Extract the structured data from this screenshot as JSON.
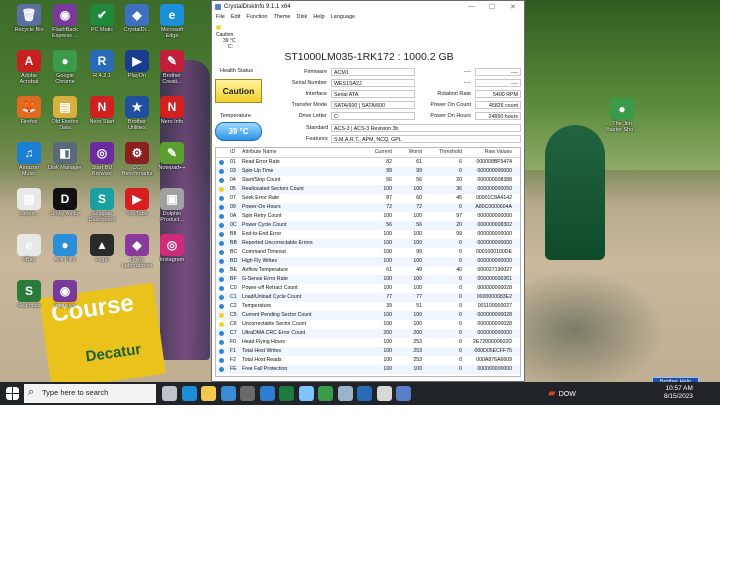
{
  "desktop_icons": [
    {
      "label": "Recycle Bin",
      "glyph": "🗑",
      "color": "#5b6fa0"
    },
    {
      "label": "FlashBack\nExpress ...",
      "glyph": "◉",
      "color": "#7a3a9a"
    },
    {
      "label": "PC Matic",
      "glyph": "✔",
      "color": "#1f8a3a"
    },
    {
      "label": "CrystalDi...",
      "glyph": "◆",
      "color": "#3f6fc0"
    },
    {
      "label": "Microsoft\nEdge",
      "glyph": "e",
      "color": "#1b8fd8"
    },
    {
      "label": "Adobe\nAcrobat",
      "glyph": "A",
      "color": "#c8201f"
    },
    {
      "label": "Google\nChrome",
      "glyph": "●",
      "color": "#3a9b4a"
    },
    {
      "label": "R 4.2.1",
      "glyph": "R",
      "color": "#2a6bb8"
    },
    {
      "label": "PlayOn",
      "glyph": "▶",
      "color": "#1a3d8f"
    },
    {
      "label": "Brother\nCreati...",
      "glyph": "✎",
      "color": "#c21f3a"
    },
    {
      "label": "Firefox",
      "glyph": "🦊",
      "color": "#e06a1f"
    },
    {
      "label": "Old Firefox\nData",
      "glyph": "▤",
      "color": "#d8b040"
    },
    {
      "label": "Nero Start",
      "glyph": "N",
      "color": "#d02020"
    },
    {
      "label": "Brother\nUtilities",
      "glyph": "★",
      "color": "#1f4fa0"
    },
    {
      "label": "Nero Info",
      "glyph": "N",
      "color": "#d02020"
    },
    {
      "label": "Amazon\nMusic",
      "glyph": "♫",
      "color": "#1a7fd0"
    },
    {
      "label": "Disk Manager",
      "glyph": "◧",
      "color": "#5a6a7a"
    },
    {
      "label": "Start BU\nBrowser",
      "glyph": "◎",
      "color": "#6a2aa0"
    },
    {
      "label": "CCI\nBenchmarks",
      "glyph": "⚙",
      "color": "#8a2020"
    },
    {
      "label": "Notepad++",
      "glyph": "✎",
      "color": "#5aa030"
    },
    {
      "label": "Lanes...",
      "glyph": "▤",
      "color": "#e8e8e8"
    },
    {
      "label": "Dolby Audio",
      "glyph": "D",
      "color": "#111111"
    },
    {
      "label": "Seagate\nDashboard",
      "glyph": "S",
      "color": "#1aa0a0"
    },
    {
      "label": "YouTube",
      "glyph": "▶",
      "color": "#d81f1f"
    },
    {
      "label": "Dolphin\nProduct...",
      "glyph": "▣",
      "color": "#a0a0a0"
    },
    {
      "label": "eBay",
      "glyph": "e",
      "color": "#e8e8e8"
    },
    {
      "label": "Ask Pilot",
      "glyph": "●",
      "color": "#2a8fd8"
    },
    {
      "label": "Legal",
      "glyph": "▲",
      "color": "#2a2a2a"
    },
    {
      "label": "Dolby\nLaboratories",
      "glyph": "◆",
      "color": "#8a3a9a"
    },
    {
      "label": "Instagram",
      "glyph": "◎",
      "color": "#d02a7a"
    },
    {
      "label": "Seafoods",
      "glyph": "S",
      "color": "#2a7a3a"
    },
    {
      "label": "Inclusive",
      "glyph": "◉",
      "color": "#7a3a9a"
    },
    {
      "label": "The Jim\nBaxter Sho...",
      "glyph": "●",
      "color": "#3a9b4a"
    }
  ],
  "photo": {
    "sign_title": "Course",
    "sign_name": "Decatur"
  },
  "window": {
    "title": "CrystalDiskInfo 9.1.1 x64",
    "controls": {
      "minimize": "—",
      "maximize": "☐",
      "close": "✕"
    },
    "menu": [
      "File",
      "Edit",
      "Function",
      "Theme",
      "Disk",
      "Help",
      "Language"
    ],
    "disk_tab": {
      "status": "Caution",
      "temp": "39 °C",
      "drive": "C:"
    },
    "drive_header": "ST1000LM035-1RK172 : 1000.2 GB",
    "health_label": "Health Status",
    "health_value": "Caution",
    "temperature_label": "Temperature",
    "temperature_value": "39 °C",
    "info_left": [
      {
        "label": "Firmware",
        "value": "ACM1"
      },
      {
        "label": "Serial Number",
        "value": "WES1SA2J"
      },
      {
        "label": "Interface",
        "value": "Serial ATA"
      },
      {
        "label": "Transfer Mode",
        "value": "SATA/600 | SATA/600"
      },
      {
        "label": "Drive Letter",
        "value": "C:"
      }
    ],
    "info_right": [
      {
        "label": "----",
        "value": "----"
      },
      {
        "label": "----",
        "value": "----"
      },
      {
        "label": "Rotation Rate",
        "value": "5400 RPM"
      },
      {
        "label": "Power On Count",
        "value": "45826 count"
      },
      {
        "label": "Power On Hours",
        "value": "24650 hours"
      }
    ],
    "standard_label": "Standard",
    "standard_value": "ACS-3 | ACS-3 Revision 3b",
    "features_label": "Features",
    "features_value": "S.M.A.R.T., APM, NCQ, GPL",
    "smart_headers": [
      "ID",
      "Attribute Name",
      "Current",
      "Worst",
      "Threshold",
      "Raw Values"
    ],
    "smart_rows": [
      {
        "status": "good",
        "id": "01",
        "name": "Read Error Rate",
        "current": "82",
        "worst": "61",
        "threshold": "6",
        "raw": "000008BF5474"
      },
      {
        "status": "good",
        "id": "03",
        "name": "Spin-Up Time",
        "current": "99",
        "worst": "99",
        "threshold": "0",
        "raw": "000000000000"
      },
      {
        "status": "good",
        "id": "04",
        "name": "Start/Stop Count",
        "current": "56",
        "worst": "56",
        "threshold": "20",
        "raw": "000000008388"
      },
      {
        "status": "caution",
        "id": "05",
        "name": "Reallocated Sectors Count",
        "current": "100",
        "worst": "100",
        "threshold": "36",
        "raw": "000000000050"
      },
      {
        "status": "good",
        "id": "07",
        "name": "Seek Error Rate",
        "current": "87",
        "worst": "60",
        "threshold": "45",
        "raw": "00001C8A4142"
      },
      {
        "status": "good",
        "id": "09",
        "name": "Power-On Hours",
        "current": "72",
        "worst": "72",
        "threshold": "0",
        "raw": "A80C0000604A"
      },
      {
        "status": "good",
        "id": "0A",
        "name": "Spin Retry Count",
        "current": "100",
        "worst": "100",
        "threshold": "97",
        "raw": "000000000000"
      },
      {
        "status": "good",
        "id": "0C",
        "name": "Power Cycle Count",
        "current": "56",
        "worst": "56",
        "threshold": "20",
        "raw": "000000008302"
      },
      {
        "status": "good",
        "id": "B8",
        "name": "End-to-End Error",
        "current": "100",
        "worst": "100",
        "threshold": "99",
        "raw": "000000000000"
      },
      {
        "status": "good",
        "id": "BB",
        "name": "Reported Uncorrectable Errors",
        "current": "100",
        "worst": "100",
        "threshold": "0",
        "raw": "000000000000"
      },
      {
        "status": "good",
        "id": "BC",
        "name": "Command Timeout",
        "current": "100",
        "worst": "99",
        "threshold": "0",
        "raw": "0001000100DE"
      },
      {
        "status": "good",
        "id": "BD",
        "name": "High Fly Writes",
        "current": "100",
        "worst": "100",
        "threshold": "0",
        "raw": "000000000000"
      },
      {
        "status": "good",
        "id": "BE",
        "name": "Airflow Temperature",
        "current": "61",
        "worst": "49",
        "threshold": "40",
        "raw": "000027190027"
      },
      {
        "status": "good",
        "id": "BF",
        "name": "G-Sense Error Rate",
        "current": "100",
        "worst": "100",
        "threshold": "0",
        "raw": "000000000361"
      },
      {
        "status": "good",
        "id": "C0",
        "name": "Power-off Retract Count",
        "current": "100",
        "worst": "100",
        "threshold": "0",
        "raw": "000000000028"
      },
      {
        "status": "good",
        "id": "C1",
        "name": "Load/Unload Cycle Count",
        "current": "77",
        "worst": "77",
        "threshold": "0",
        "raw": "0000000083E2"
      },
      {
        "status": "good",
        "id": "C2",
        "name": "Temperature",
        "current": "39",
        "worst": "51",
        "threshold": "0",
        "raw": "001100000027"
      },
      {
        "status": "caution",
        "id": "C5",
        "name": "Current Pending Sector Count",
        "current": "100",
        "worst": "100",
        "threshold": "0",
        "raw": "000000000028"
      },
      {
        "status": "caution",
        "id": "C6",
        "name": "Uncorrectable Sector Count",
        "current": "100",
        "worst": "100",
        "threshold": "0",
        "raw": "000000000028"
      },
      {
        "status": "good",
        "id": "C7",
        "name": "UltraDMA CRC Error Count",
        "current": "200",
        "worst": "200",
        "threshold": "0",
        "raw": "000000000000"
      },
      {
        "status": "good",
        "id": "F0",
        "name": "Head Flying Hours",
        "current": "100",
        "worst": "253",
        "threshold": "0",
        "raw": "2E7200000602D"
      },
      {
        "status": "good",
        "id": "F1",
        "name": "Total Host Writes",
        "current": "100",
        "worst": "253",
        "threshold": "0",
        "raw": "000D05ECFF75"
      },
      {
        "status": "good",
        "id": "F2",
        "name": "Total Host Reads",
        "current": "100",
        "worst": "253",
        "threshold": "0",
        "raw": "000A876A6609"
      },
      {
        "status": "good",
        "id": "FE",
        "name": "Free Fall Protection",
        "current": "100",
        "worst": "100",
        "threshold": "0",
        "raw": "000000000000"
      }
    ],
    "status_colors": {
      "good": "#2f86d6",
      "caution": "#f2cf2a"
    }
  },
  "taskbar": {
    "search_placeholder": "Type here to search",
    "weather": "DOW",
    "time": "10:57 AM",
    "date": "8/15/2023",
    "brother_help": "Brother Help",
    "apps": [
      {
        "name": "task-view-icon",
        "color": "#bfc4cc"
      },
      {
        "name": "edge-icon",
        "color": "#1b8fd8"
      },
      {
        "name": "file-explorer-icon",
        "color": "#f2c94c"
      },
      {
        "name": "mail-icon",
        "color": "#3b8bd8"
      },
      {
        "name": "calculator-icon",
        "color": "#6a6a6a"
      },
      {
        "name": "store-icon",
        "color": "#2f7bd0"
      },
      {
        "name": "excel-icon",
        "color": "#1f7a3f"
      },
      {
        "name": "notepad-icon",
        "color": "#7fc4ff"
      },
      {
        "name": "chrome-icon",
        "color": "#3a9b4a"
      },
      {
        "name": "onedrive-icon",
        "color": "#9ab3c8"
      },
      {
        "name": "photos-icon",
        "color": "#2a6bb8"
      },
      {
        "name": "settings-icon",
        "color": "#d8d8d8"
      },
      {
        "name": "crystaldiskinfo-icon",
        "color": "#5a7fc8"
      }
    ]
  }
}
